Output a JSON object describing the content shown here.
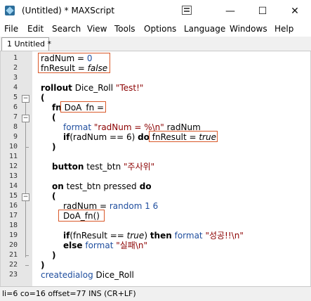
{
  "window": {
    "title": "(Untitled) * MAXScript",
    "min_glyph": "—",
    "max_glyph": "☐",
    "close_glyph": "✕"
  },
  "menu": [
    "File",
    "Edit",
    "Search",
    "View",
    "Tools",
    "Options",
    "Language",
    "Windows",
    "Help"
  ],
  "tab": {
    "label": "1 Untitled *"
  },
  "line_numbers": [
    "1",
    "2",
    "3",
    "4",
    "5",
    "6",
    "7",
    "8",
    "9",
    "10",
    "11",
    "12",
    "13",
    "14",
    "15",
    "16",
    "17",
    "18",
    "19",
    "20",
    "21",
    "22",
    "23"
  ],
  "code": {
    "l1": {
      "a": "radNum",
      "b": " = ",
      "c": "0"
    },
    "l2": {
      "a": "fnResult",
      "b": " = ",
      "c": "false"
    },
    "l4": {
      "a": "rollout",
      "b": " Dice_Roll ",
      "c": "\"Test!\""
    },
    "l5": "(",
    "l6": {
      "a": "fn",
      "b": " DoA_fn ",
      "c": "="
    },
    "l7": "(",
    "l8": {
      "a": "format",
      "b": " \"radNum = %\\n\" ",
      "c": "radNum"
    },
    "l9": {
      "a": "if",
      "b": "(radNum == 6) ",
      "c": "do",
      "d": " fnResult = ",
      "e": "true"
    },
    "l10": ")",
    "l12": {
      "a": "button",
      "b": " test_btn ",
      "c": "\"주사위\""
    },
    "l14": {
      "a": "on",
      "b": " test_btn ",
      "c": "pressed",
      "d": " do"
    },
    "l15": "(",
    "l16": {
      "a": "radNum",
      "b": " = ",
      "c": "random 1 6"
    },
    "l17": {
      "a": "DoA_fn()"
    },
    "l19": {
      "a": "if",
      "b": "(fnResult == ",
      "c": "true",
      "d": ") ",
      "e": "then",
      "f": " format ",
      "g": "\"성공!!\\n\""
    },
    "l20": {
      "a": "else",
      "b": " format ",
      "c": "\"실패\\n\""
    },
    "l21": ")",
    "l22": ")",
    "l23": {
      "a": "createdialog",
      "b": " Dice_Roll"
    }
  },
  "status": "li=6 co=16 offset=77 INS (CR+LF)",
  "colors": {
    "highlight_box": "#d9592a",
    "gutter": "#e6e6e6",
    "string": "#8b0000",
    "builtin": "#1f4e9e"
  }
}
